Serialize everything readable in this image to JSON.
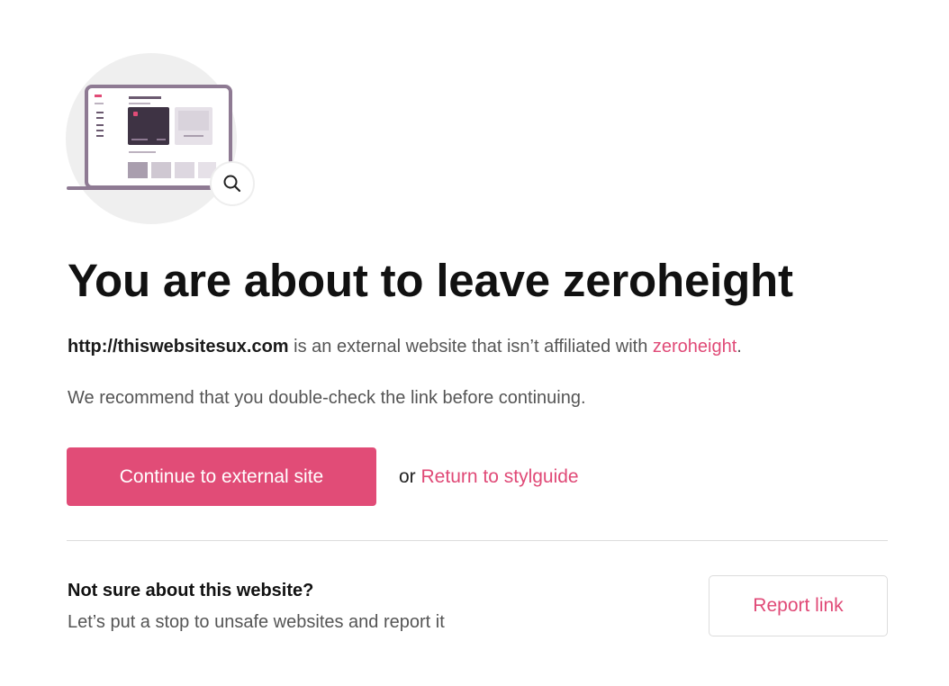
{
  "illustration": {
    "icon": "laptop-with-magnifier-illustration",
    "magnifier_icon": "search-icon",
    "colors": {
      "circle_bg": "#efefef",
      "laptop_frame": "#8e7a93",
      "dark_card": "#3e3344",
      "light_tiles": "#d9d3dc",
      "accent_dot": "#e14c77"
    }
  },
  "title": "You are about to leave zeroheight",
  "external_notice": {
    "url": "http://thiswebsitesux.com",
    "middle_text": " is an external website that isn’t affiliated with ",
    "brand_link": "zeroheight",
    "end_punct": "."
  },
  "recommendation": "We recommend that you double-check the link before continuing.",
  "actions": {
    "continue_label": "Continue to external site",
    "or_text": "or ",
    "return_label": "Return to stylguide"
  },
  "report": {
    "heading": "Not sure about this website?",
    "description": "Let’s put a stop to unsafe websites and report it",
    "button_label": "Report link"
  },
  "colors": {
    "accent": "#e14c77",
    "link": "#e04a77",
    "heading": "#111111",
    "body_text": "#555555",
    "divider": "#dddddd"
  }
}
